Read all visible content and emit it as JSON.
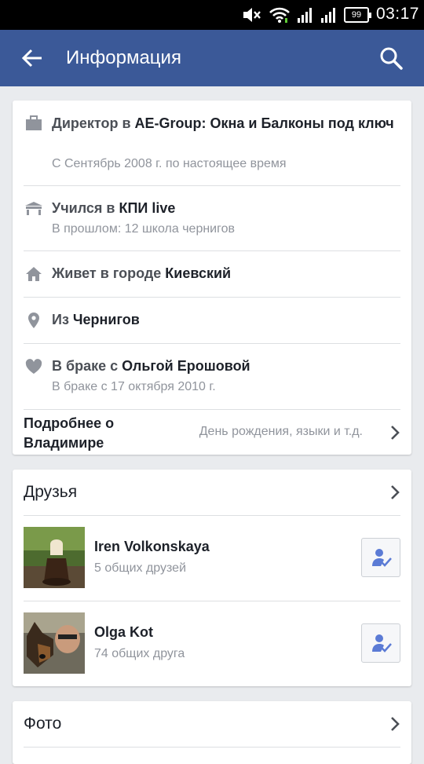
{
  "status_bar": {
    "battery": "99",
    "time": "03:17",
    "icons": [
      "mute-icon",
      "wifi-icon",
      "signal-icon",
      "signal-icon"
    ]
  },
  "app_bar": {
    "title": "Информация",
    "back_icon": "arrow-left-icon",
    "search_icon": "search-icon",
    "color": "#3b5998"
  },
  "info": {
    "work": {
      "prefix": "Директор в ",
      "name": "AE-Group: Окна и Балконы под ключ",
      "sub": "С Сентябрь 2008 г. по настоящее время",
      "icon": "briefcase-icon"
    },
    "education": {
      "prefix": "Учился в ",
      "name": "КПИ live",
      "sub": "В прошлом: 12 школа чернигов",
      "icon": "school-icon"
    },
    "lives": {
      "prefix": "Живет в городе ",
      "name": "Киевский",
      "icon": "home-icon"
    },
    "from": {
      "prefix": "Из ",
      "name": "Чернигов",
      "icon": "location-pin-icon"
    },
    "relationship": {
      "prefix": "В браке с ",
      "name": "Ольгой Ерошовой",
      "sub": "В браке с 17 октября 2010 г.",
      "icon": "heart-icon"
    },
    "more": {
      "label": "Подробнее о Владимире",
      "detail": "День рождения, языки и т.д."
    }
  },
  "friends": {
    "title": "Друзья",
    "items": [
      {
        "name": "Iren Volkonskaya",
        "mutual": "5 общих друзей"
      },
      {
        "name": "Olga Kot",
        "mutual": "74 общих друга"
      }
    ]
  },
  "photos": {
    "title": "Фото"
  }
}
